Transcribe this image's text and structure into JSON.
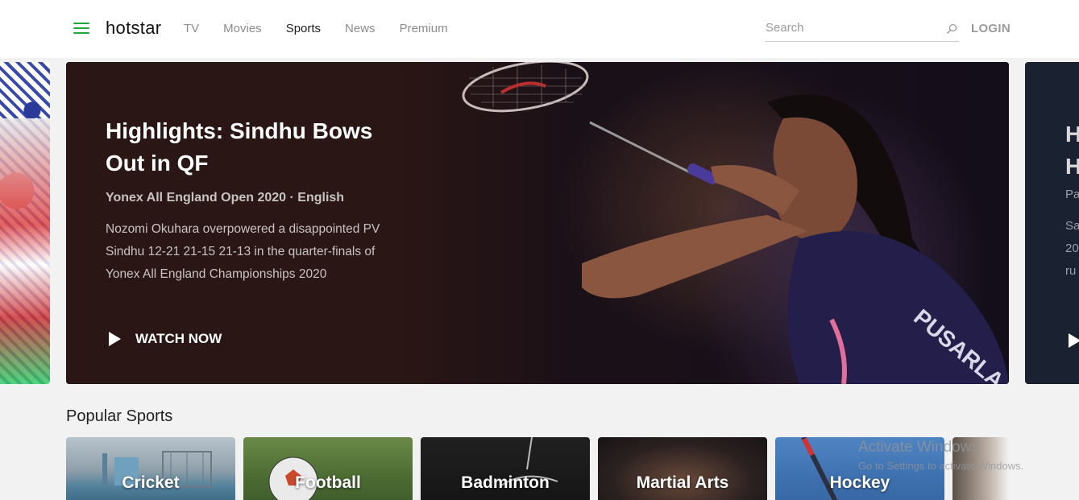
{
  "header": {
    "logo": "hotstar",
    "nav": [
      "TV",
      "Movies",
      "Sports",
      "News",
      "Premium"
    ],
    "active_nav": "Sports",
    "search_placeholder": "Search",
    "login_label": "LOGIN",
    "accent_color": "#1ca839"
  },
  "hero": {
    "title": "Highlights: Sindhu Bows Out in QF",
    "meta": "Yonex All England Open 2020 · English",
    "description": "Nozomi Okuhara overpowered a disappointed PV Sindhu 12-21 21-15 21-13 in the quarter-finals of Yonex All England Championships 2020",
    "watch_label": "WATCH NOW",
    "jersey_text": "PUSARLA INDIA"
  },
  "next_slide": {
    "title_fragment": "H\nH",
    "meta_fragment": "Pa",
    "desc_fragment": "Sa\n20\nru"
  },
  "popular": {
    "title": "Popular Sports",
    "tiles": [
      "Cricket",
      "Football",
      "Badminton",
      "Martial Arts",
      "Hockey"
    ]
  },
  "watermark": {
    "line1": "Activate Windows",
    "line2": "Go to Settings to activate Windows."
  }
}
